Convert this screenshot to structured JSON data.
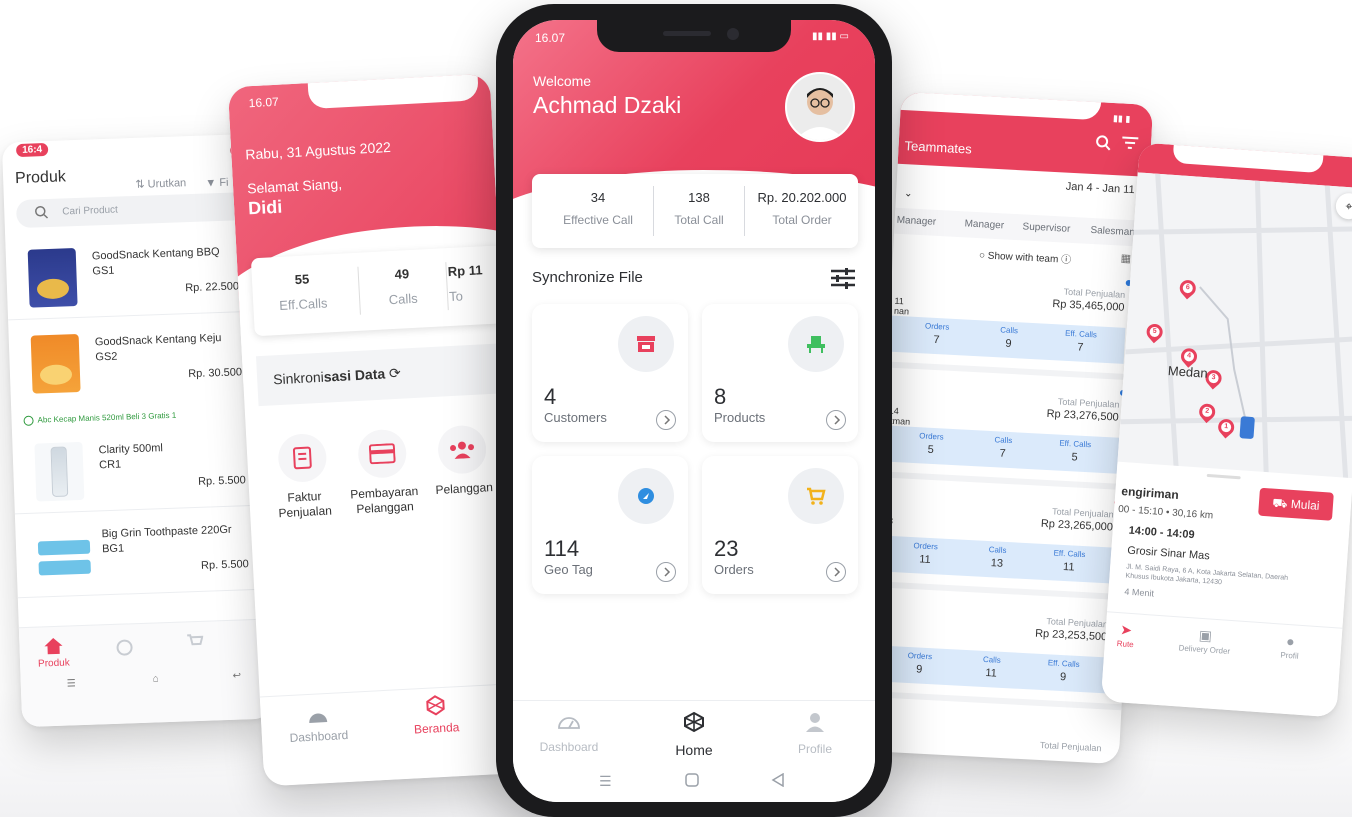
{
  "colors": {
    "accent": "#e8415d",
    "text": "#2d2f33",
    "muted": "#8a8f98",
    "blue_band": "#dbeafb"
  },
  "produk_screen": {
    "status_time": "16:4",
    "title": "Produk",
    "sort_label": "Urutkan",
    "filter_label": "Fi",
    "search_placeholder": "Cari Product",
    "products": [
      {
        "name": "GoodSnack Kentang BBQ",
        "code": "GS1",
        "price": "Rp. 22.500"
      },
      {
        "name": "GoodSnack Kentang Keju",
        "code": "GS2",
        "price": "Rp. 30.500"
      },
      {
        "name": "Clarity 500ml",
        "code": "CR1",
        "price": "Rp. 5.500"
      },
      {
        "name": "Big Grin Toothpaste 220Gr",
        "code": "BG1",
        "price": "Rp. 5.500"
      }
    ],
    "promo": "Abc Kecap Manis 520ml Beli 3 Gratis 1",
    "nav_active": "Produk"
  },
  "beranda_screen": {
    "status_time": "16.07",
    "date": "Rabu, 31 Agustus 2022",
    "greeting": "Selamat Siang,",
    "name": "Didi",
    "stats": [
      {
        "value": "55",
        "label": "Eff.Calls"
      },
      {
        "value": "49",
        "label": "Calls"
      },
      {
        "value": "Rp 11",
        "label": "To"
      }
    ],
    "sync_title_a": "Sinkroni",
    "sync_title_b": "sasi Data",
    "menus": [
      {
        "label": "Faktur Penjualan"
      },
      {
        "label": "Pembayaran Pelanggan"
      },
      {
        "label": "Pelanggan"
      }
    ],
    "nav": {
      "dashboard": "Dashboard",
      "beranda": "Beranda"
    }
  },
  "home_screen": {
    "status_time": "16.07",
    "welcome": "Welcome",
    "user_name": "Achmad Dzaki",
    "stats": [
      {
        "value": "34",
        "label": "Effective Call"
      },
      {
        "value": "138",
        "label": "Total Call"
      },
      {
        "value": "Rp. 20.202.000",
        "label": "Total Order"
      }
    ],
    "sync_title": "Synchronize File",
    "tiles": [
      {
        "count": "4",
        "label": "Customers",
        "icon": "store-icon"
      },
      {
        "count": "8",
        "label": "Products",
        "icon": "chair-icon"
      },
      {
        "count": "114",
        "label": "Geo Tag",
        "icon": "location-icon"
      },
      {
        "count": "23",
        "label": "Orders",
        "icon": "cart-icon"
      }
    ],
    "nav": {
      "dashboard": "Dashboard",
      "home": "Home",
      "profile": "Profile"
    }
  },
  "team_screen": {
    "title": "Teammates",
    "date_range": "Jan 4 - Jan 11",
    "tabs": [
      "Manager",
      "Manager",
      "Supervisor",
      "Salesman"
    ],
    "show_with_team": "Show with team",
    "col_orders": "Orders",
    "col_calls": "Calls",
    "col_eff": "Eff. Calls",
    "total_label": "Total Penjualan",
    "members": [
      {
        "id": "11",
        "name": "nan",
        "total": "Rp 35,465,000",
        "orders": "7",
        "calls": "9",
        "eff": "7",
        "dot": "#2f7de1"
      },
      {
        "id": "14",
        "name": "kman",
        "total": "Rp 23,276,500",
        "orders": "5",
        "calls": "7",
        "eff": "5",
        "dot": "#2f7de1"
      },
      {
        "id": "13",
        "name": "",
        "total": "Rp 23,265,000",
        "orders": "11",
        "calls": "13",
        "eff": "11",
        "dot": "#e8415d"
      },
      {
        "id": "12",
        "name": "son",
        "total": "Rp 23,253,500",
        "orders": "9",
        "calls": "11",
        "eff": "9",
        "dot": "#2f7de1"
      }
    ],
    "last_row_id": "16"
  },
  "map_screen": {
    "city_label": "Medan",
    "pins": [
      "6",
      "5",
      "4",
      "3",
      "2",
      "1"
    ],
    "section_title": "engiriman",
    "meta": "00 - 15:10 • 30,16 km",
    "start_button": "Mulai",
    "slot_time": "14:00 - 14:09",
    "store_name": "Grosir Sinar Mas",
    "address": "Jl. M. Saidi Raya, 6 A, Kota Jakarta Selatan, Daerah Khusus Ibukota Jakarta, 12430",
    "eta": "4 Menit",
    "nav": {
      "rute": "Rute",
      "delivery": "Delivery Order",
      "profil": "Profil"
    }
  }
}
